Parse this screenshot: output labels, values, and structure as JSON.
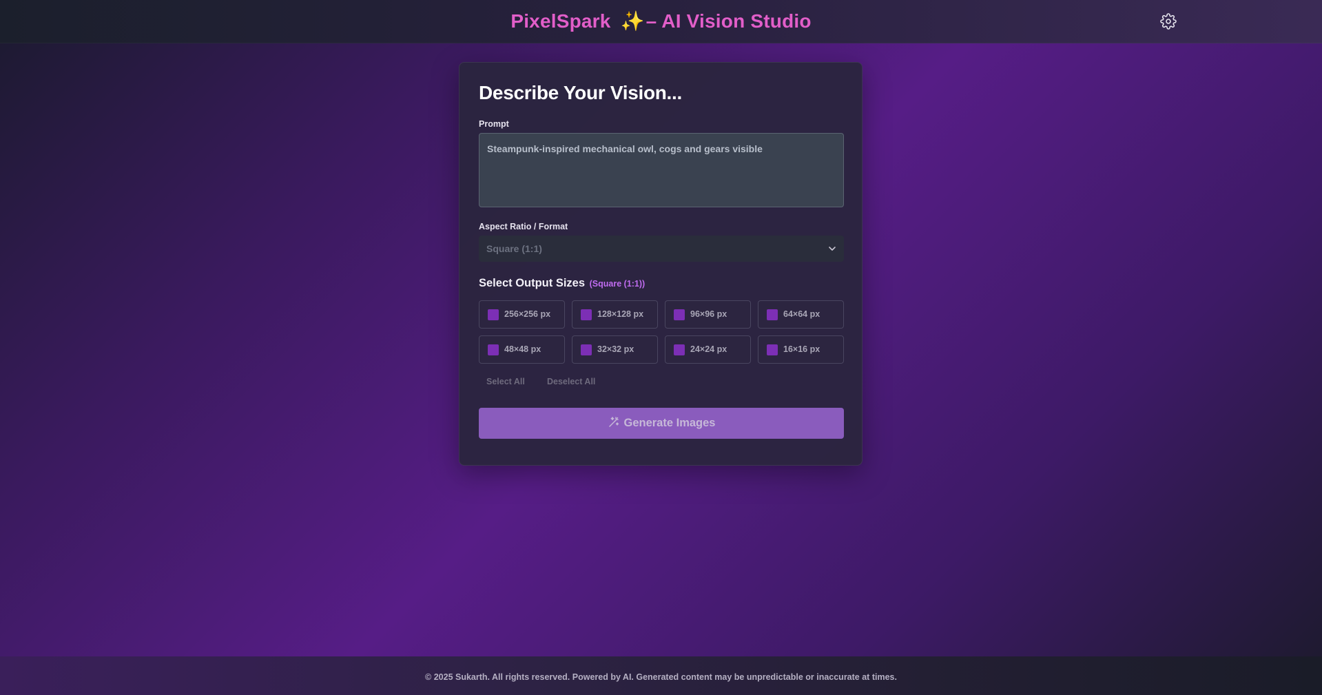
{
  "header": {
    "title": "PixelSpark",
    "title_suffix": "– AI Vision Studio",
    "sparkle_glyph": "✨",
    "settings_icon": "gear-icon"
  },
  "form": {
    "heading": "Describe Your Vision...",
    "prompt_label": "Prompt",
    "prompt_value": "Steampunk-inspired mechanical owl, cogs and gears visible",
    "aspect_label": "Aspect Ratio / Format",
    "aspect_value": "Square (1:1)",
    "sizes_heading": "Select Output Sizes",
    "sizes_ratio": "(Square (1:1))",
    "sizes": [
      {
        "label": "256×256 px",
        "checked": false
      },
      {
        "label": "128×128 px",
        "checked": false
      },
      {
        "label": "96×96 px",
        "checked": false
      },
      {
        "label": "64×64 px",
        "checked": false
      },
      {
        "label": "48×48 px",
        "checked": false
      },
      {
        "label": "32×32 px",
        "checked": false
      },
      {
        "label": "24×24 px",
        "checked": false
      },
      {
        "label": "16×16 px",
        "checked": false
      }
    ],
    "select_all": "Select All",
    "deselect_all": "Deselect All",
    "generate_label": "Generate Images",
    "generate_icon": "magic-wand-icon"
  },
  "footer": {
    "text": "© 2025 Sukarth. All rights reserved. Powered by AI. Generated content may be unpredictable or inaccurate at times."
  },
  "colors": {
    "accent": "#e25ec9",
    "button": "#8a5cbd",
    "checkbox": "#7c2fb5"
  }
}
